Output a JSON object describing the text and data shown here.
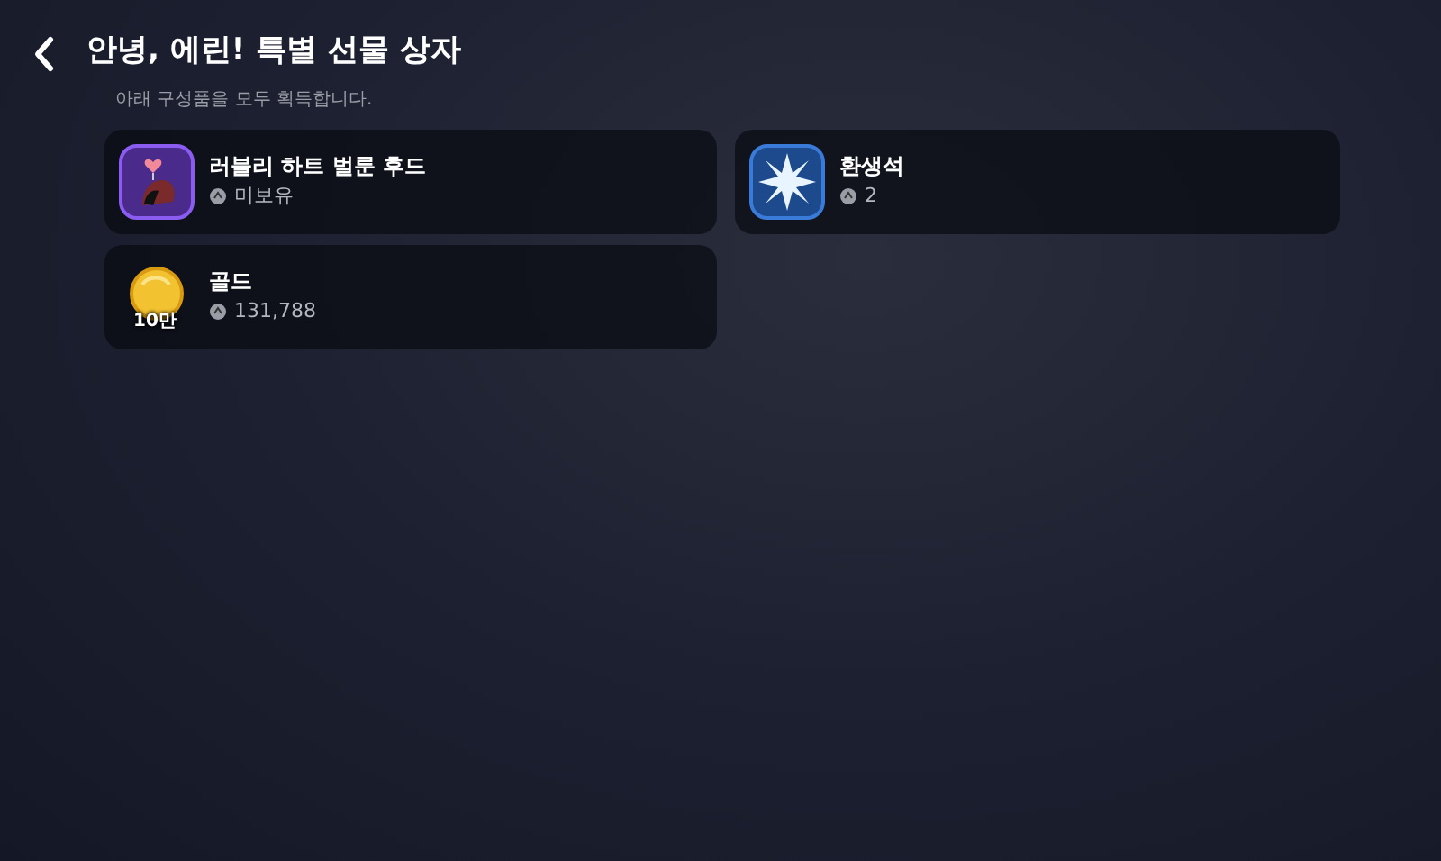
{
  "header": {
    "title": "안녕, 에린! 특별 선물 상자"
  },
  "subtitle": "아래 구성품을 모두 획득합니다.",
  "items": [
    {
      "kind": "costume",
      "name": "러블리 하트 벌룬 후드",
      "owned": "미보유"
    },
    {
      "kind": "star",
      "name": "환생석",
      "owned": "2"
    },
    {
      "kind": "gold",
      "name": "골드",
      "badge": "10만",
      "owned": "131,788"
    }
  ]
}
